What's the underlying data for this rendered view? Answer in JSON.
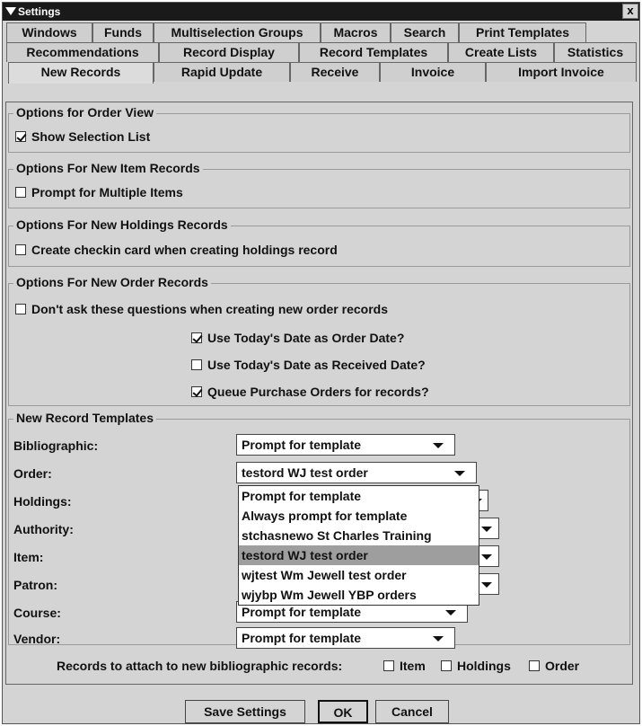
{
  "window": {
    "title": "Settings",
    "close_label": "x"
  },
  "tabs": {
    "row1": [
      "Windows",
      "Funds",
      "Multiselection Groups",
      "Macros",
      "Search",
      "Print Templates"
    ],
    "row2": [
      "Recommendations",
      "Record Display",
      "Record Templates",
      "Create Lists",
      "Statistics"
    ],
    "row3": [
      "New Records",
      "Rapid Update",
      "Receive",
      "Invoice",
      "Import Invoice"
    ],
    "active": "New Records"
  },
  "order_view": {
    "title": "Options for Order View",
    "show_selection_list": {
      "label": "Show Selection List",
      "checked": true
    }
  },
  "new_item": {
    "title": "Options For New Item Records",
    "prompt_multiple": {
      "label": "Prompt for Multiple Items",
      "checked": false
    }
  },
  "new_holdings": {
    "title": "Options For New Holdings Records",
    "checkin_card": {
      "label": "Create checkin card when creating holdings record",
      "checked": false
    }
  },
  "new_order": {
    "title": "Options For New Order Records",
    "dont_ask": {
      "label": "Don't ask these questions when creating new order records",
      "checked": false
    },
    "todays_order_date": {
      "label": "Use Today's Date as Order Date?",
      "checked": true
    },
    "todays_received_date": {
      "label": "Use Today's Date as Received Date?",
      "checked": false
    },
    "queue_po": {
      "label": "Queue Purchase Orders for records?",
      "checked": true
    }
  },
  "templates": {
    "title": "New Record Templates",
    "bibliographic": {
      "label": "Bibliographic:",
      "value": "Prompt for template"
    },
    "order": {
      "label": "Order:",
      "value": "testord WJ test order"
    },
    "holdings": {
      "label": "Holdings:"
    },
    "authority": {
      "label": "Authority:"
    },
    "item": {
      "label": "Item:"
    },
    "patron": {
      "label": "Patron:"
    },
    "course": {
      "label": "Course:",
      "value": "Prompt for template"
    },
    "vendor": {
      "label": "Vendor:",
      "value": "Prompt for template"
    },
    "open_options": [
      "Prompt for template",
      "Always prompt for template",
      "stchasnewo St Charles Training",
      "testord WJ test order",
      "wjtest Wm Jewell test order",
      "wjybp Wm Jewell YBP orders"
    ],
    "open_selected": "testord WJ test order"
  },
  "attach": {
    "label": "Records to attach to new bibliographic records:",
    "item": {
      "label": "Item",
      "checked": false
    },
    "holdings": {
      "label": "Holdings",
      "checked": false
    },
    "order": {
      "label": "Order",
      "checked": false
    }
  },
  "buttons": {
    "save": "Save Settings",
    "ok": "OK",
    "cancel": "Cancel"
  },
  "colors": {
    "title_bar": "#1a1a1a",
    "window_bg": "#d4d4d4",
    "selected_option": "#9e9e9e"
  }
}
